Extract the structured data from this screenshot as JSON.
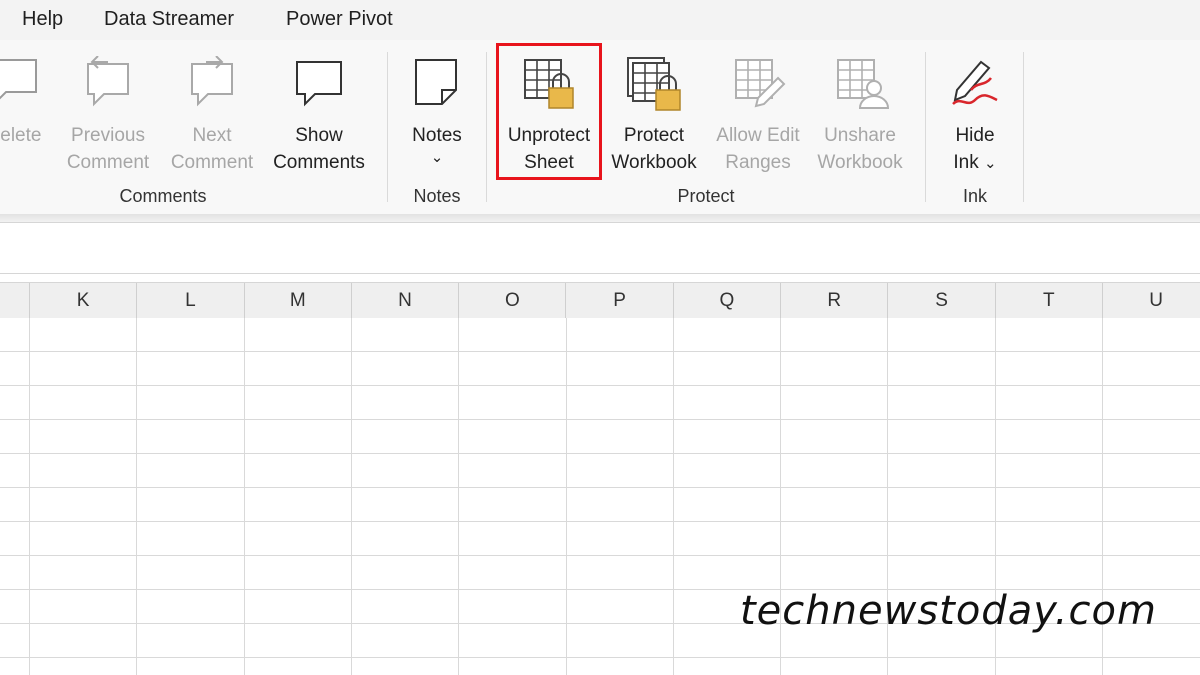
{
  "menu_tabs": [
    "Help",
    "Data Streamer",
    "Power Pivot"
  ],
  "ribbon": {
    "comments": {
      "delete_label": "Delete",
      "previous_label_line1": "Previous",
      "previous_label_line2": "Comment",
      "next_label_line1": "Next",
      "next_label_line2": "Comment",
      "show_label_line1": "Show",
      "show_label_line2": "Comments",
      "group_label": "Comments"
    },
    "notes": {
      "label": "Notes",
      "chevron": "⌄",
      "group_label": "Notes"
    },
    "protect": {
      "unprotect_sheet_line1": "Unprotect",
      "unprotect_sheet_line2": "Sheet",
      "protect_workbook_line1": "Protect",
      "protect_workbook_line2": "Workbook",
      "allow_edit_line1": "Allow Edit",
      "allow_edit_line2": "Ranges",
      "unshare_line1": "Unshare",
      "unshare_line2": "Workbook",
      "group_label": "Protect"
    },
    "ink": {
      "hide_ink_line1": "Hide",
      "hide_ink_line2": "Ink",
      "chevron": "⌄",
      "group_label": "Ink"
    }
  },
  "column_headers": [
    "K",
    "L",
    "M",
    "N",
    "O",
    "P",
    "Q",
    "R",
    "S",
    "T",
    "U"
  ],
  "watermark": "technewstoday.com",
  "colors": {
    "highlight": "#e8141c",
    "lock": "#e9b84a",
    "ink_red": "#d9262c",
    "disabled_text": "#a6a6a6"
  }
}
